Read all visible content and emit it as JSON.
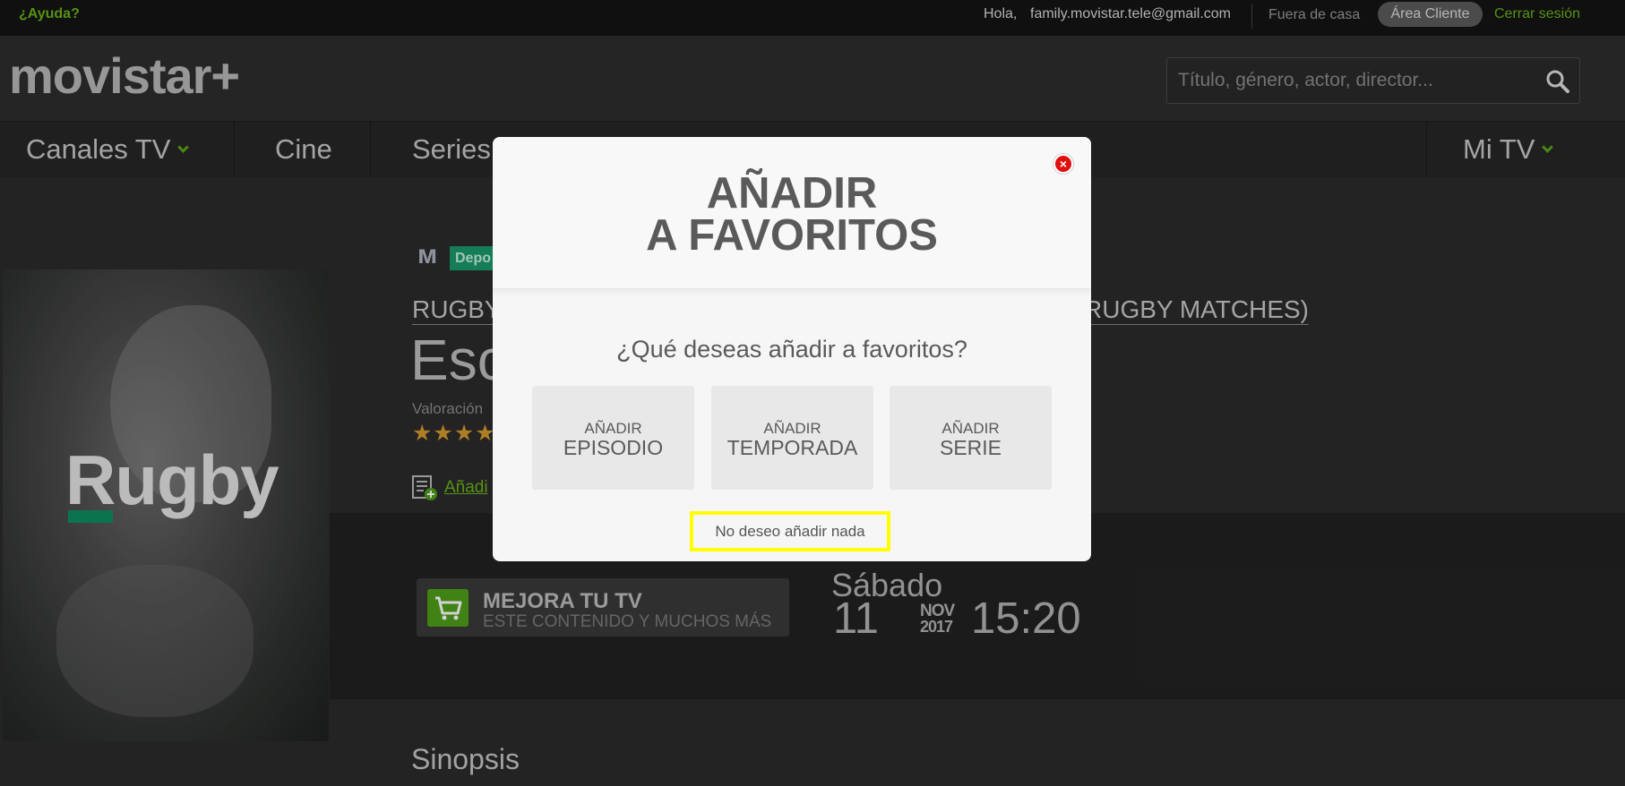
{
  "topbar": {
    "help": "¿Ayuda?",
    "hello": "Hola,",
    "email": "family.movistar.tele@gmail.com",
    "fuera": "Fuera de casa",
    "area": "Área Cliente",
    "cerrar": "Cerrar sesión"
  },
  "header": {
    "logo": "movistar+",
    "search_placeholder": "Título, género, actor, director..."
  },
  "nav": {
    "canales": "Canales TV",
    "cine": "Cine",
    "series": "Series",
    "mitv": "Mi TV"
  },
  "content": {
    "channel_badge": "Depo",
    "prog_left": "RUGBY",
    "prog_right": "RUGBY MATCHES)",
    "title": "Esc",
    "valoracion": "Valoración",
    "stars": "★★★★",
    "fav_link": "Añadi",
    "poster_title": "Rugby",
    "mejora_title": "MEJORA TU TV",
    "mejora_sub": "ESTE CONTENIDO Y MUCHOS MÁS",
    "day_name": "Sábado",
    "day_num": "11",
    "month": "NOV",
    "year": "2017",
    "hour": "15:20",
    "sinopsis": "Sinopsis"
  },
  "modal": {
    "title_line1": "AÑADIR",
    "title_line2": "A FAVORITOS",
    "question": "¿Qué deseas añadir a favoritos?",
    "options": [
      {
        "small": "AÑADIR",
        "big": "EPISODIO"
      },
      {
        "small": "AÑADIR",
        "big": "TEMPORADA"
      },
      {
        "small": "AÑADIR",
        "big": "SERIE"
      }
    ],
    "nada": "No deseo añadir nada",
    "close": "×"
  },
  "colors": {
    "accent_green": "#6bb31c",
    "close_red": "#e01010",
    "highlight_yellow": "#ffff00"
  }
}
